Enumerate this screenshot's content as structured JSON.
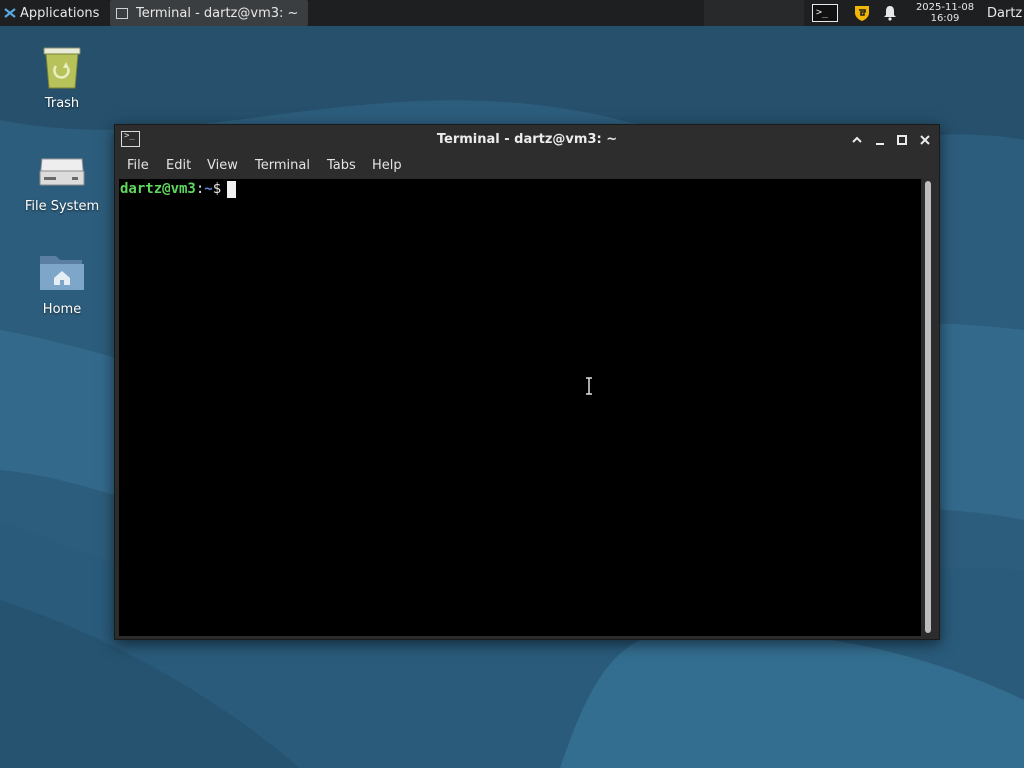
{
  "panel": {
    "applications_label": "Applications",
    "taskbar_title": "Terminal - dartz@vm3: ~",
    "clock_date": "2025-11-08",
    "clock_time": "16:09",
    "user_label": "Dartz"
  },
  "desktop": {
    "icons": [
      {
        "label": "Trash",
        "icon": "trash-icon"
      },
      {
        "label": "File System",
        "icon": "drive-icon"
      },
      {
        "label": "Home",
        "icon": "home-folder-icon"
      }
    ]
  },
  "window": {
    "title": "Terminal - dartz@vm3: ~",
    "menu": [
      "File",
      "Edit",
      "View",
      "Terminal",
      "Tabs",
      "Help"
    ]
  },
  "terminal": {
    "prompt_user": "dartz@vm3",
    "prompt_sep": ":",
    "prompt_path": "~",
    "prompt_symbol": "$"
  },
  "colors": {
    "desktop_blue": "#2c5a78",
    "panel_bg": "#1d1f20",
    "prompt_user": "#5fd75f",
    "prompt_path": "#5f87d7",
    "terminal_bg": "#000000"
  }
}
